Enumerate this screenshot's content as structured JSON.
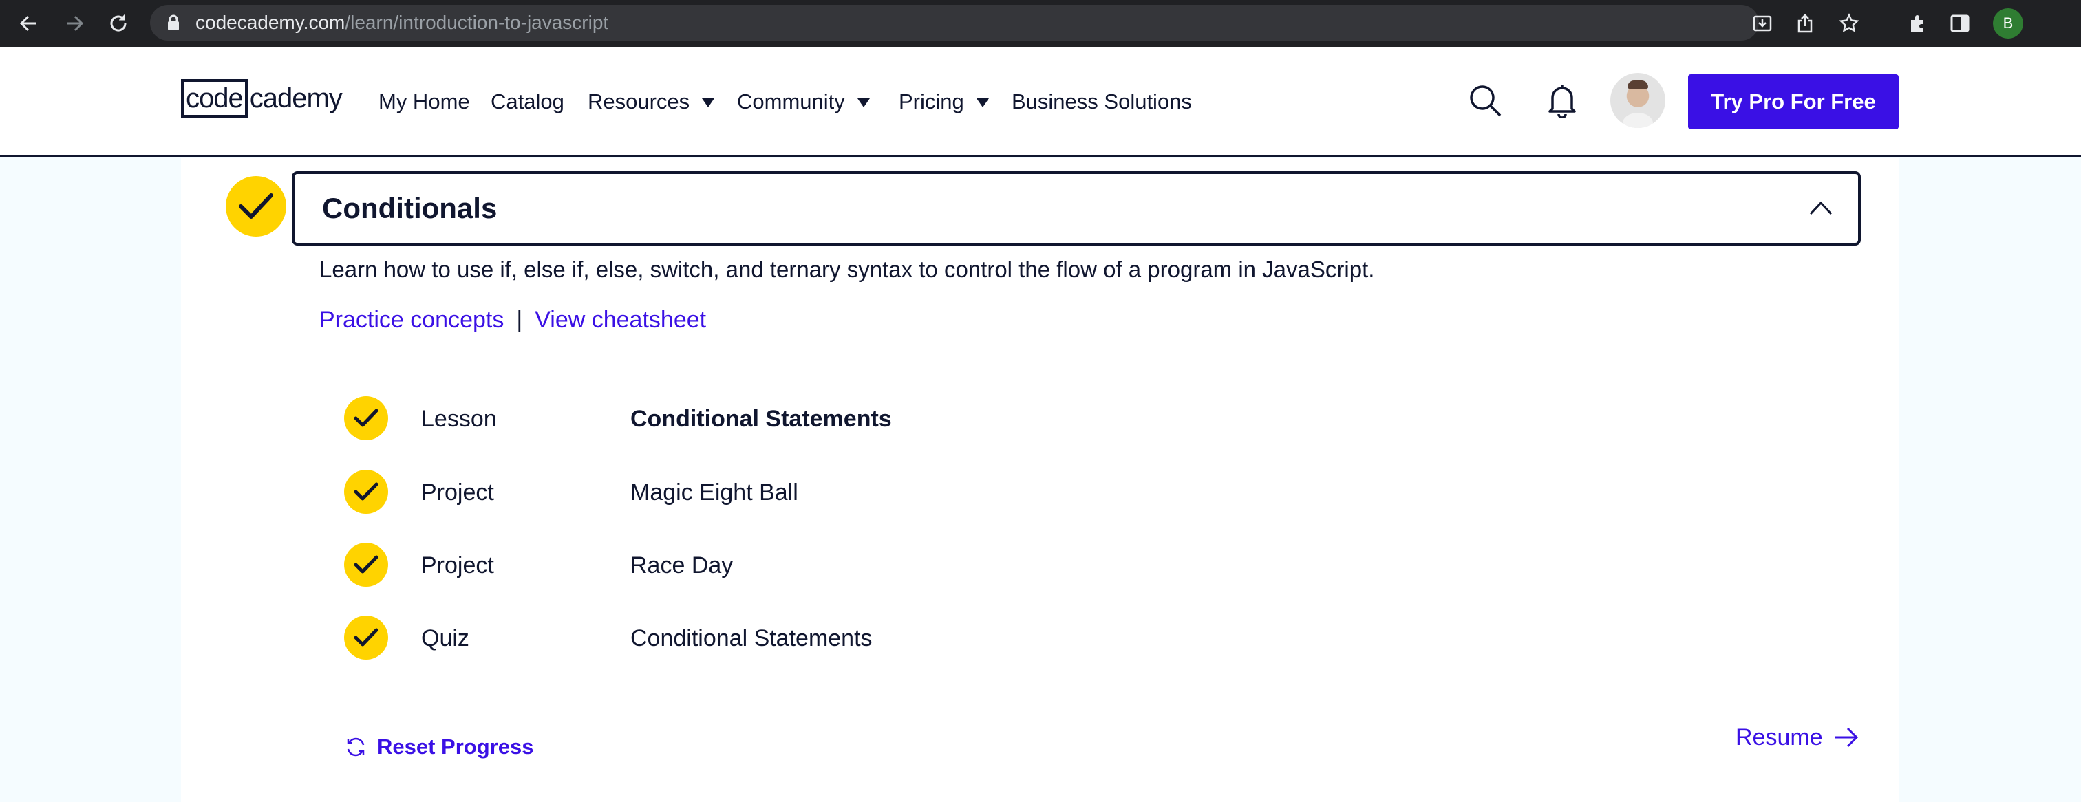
{
  "browser": {
    "url_host": "codecademy.com",
    "url_path": "/learn/introduction-to-javascript",
    "profile_initial": "B",
    "icons": [
      "back-icon",
      "forward-icon",
      "reload-icon",
      "lock-icon",
      "install-icon",
      "share-icon",
      "bookmark-star-icon",
      "extensions-icon",
      "side-panel-icon"
    ]
  },
  "header": {
    "logo_part1": "code",
    "logo_part2": "cademy",
    "nav": {
      "my_home": "My Home",
      "catalog": "Catalog",
      "resources": "Resources",
      "community": "Community",
      "pricing": "Pricing",
      "business": "Business Solutions"
    },
    "cta": "Try Pro For Free"
  },
  "module": {
    "title": "Conditionals",
    "description": "Learn how to use if, else if, else, switch, and ternary syntax to control the flow of a program in JavaScript.",
    "practice_link": "Practice concepts",
    "separator": "|",
    "cheatsheet_link": "View cheatsheet",
    "items": [
      {
        "type": "Lesson",
        "title": "Conditional Statements"
      },
      {
        "type": "Project",
        "title": "Magic Eight Ball"
      },
      {
        "type": "Project",
        "title": "Race Day"
      },
      {
        "type": "Quiz",
        "title": "Conditional Statements"
      }
    ],
    "reset_label": "Reset Progress",
    "resume_label": "Resume"
  },
  "colors": {
    "accent": "#3a10e5",
    "check": "#ffd300",
    "navy": "#10162f",
    "page_bg": "#f5fcff"
  }
}
